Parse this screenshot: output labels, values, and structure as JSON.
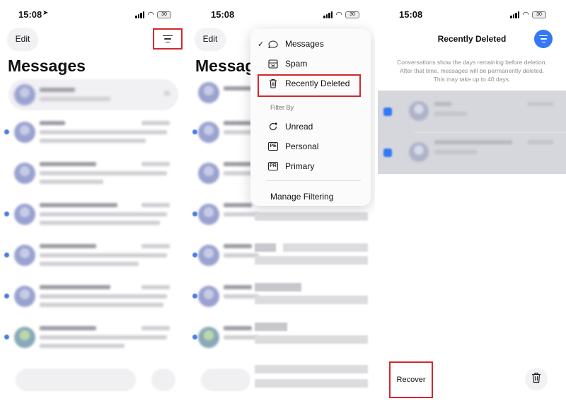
{
  "colors": {
    "accent": "#3478f6",
    "highlight": "#d3272d"
  },
  "panel1": {
    "time": "15:08",
    "battery": "30",
    "edit_label": "Edit",
    "filter_icon": "filter-lines-icon",
    "title": "Messages"
  },
  "panel2": {
    "time": "15:08",
    "battery": "30",
    "edit_label": "Edit",
    "title": "Messag",
    "menu": {
      "check": "✓",
      "messages": "Messages",
      "spam": "Spam",
      "recently_deleted": "Recently Deleted",
      "filter_by": "Filter By",
      "unread": "Unread",
      "personal": "Personal",
      "primary": "Primary",
      "personal_badge": "PE",
      "primary_badge": "PR",
      "manage": "Manage Filtering"
    }
  },
  "panel3": {
    "time": "15:08",
    "battery": "30",
    "title": "Recently Deleted",
    "info_line1": "Conversations show the days remaining before deletion.",
    "info_line2": "After that time, messages will be permanently deleted.",
    "info_line3": "This may take up to 40 days.",
    "recover_label": "Recover"
  }
}
